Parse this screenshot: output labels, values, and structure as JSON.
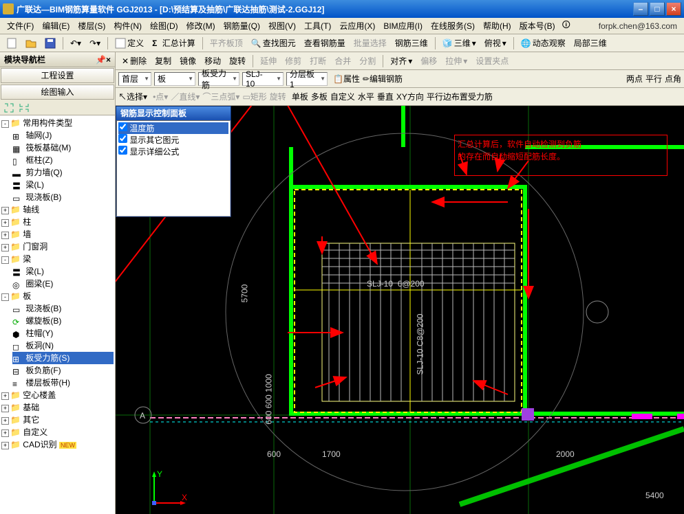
{
  "titlebar": {
    "title": "广联达—BIM钢筋算量软件 GGJ2013 - [D:\\预结算及抽筋\\广联达抽筋\\测试-2.GGJ12]"
  },
  "menubar": {
    "items": [
      "文件(F)",
      "编辑(E)",
      "楼层(S)",
      "构件(N)",
      "绘图(D)",
      "修改(M)",
      "钢筋量(Q)",
      "视图(V)",
      "工具(T)",
      "云应用(X)",
      "BIM应用(I)",
      "在线服务(S)",
      "帮助(H)",
      "版本号(B)"
    ],
    "user": "forpk.chen@163.com"
  },
  "toolbar1": {
    "back": "◄",
    "fwd": "►",
    "define": "定义",
    "sum": "汇总计算",
    "flat": "平齐板顶",
    "find": "查找图元",
    "view_rebar": "查看钢筋量",
    "batch": "批量选择",
    "rebar_3d": "钢筋三维",
    "td": "三维",
    "pan": "俯视",
    "dyn": "动态观察",
    "local3d": "局部三维"
  },
  "toolbar2": {
    "del": "删除",
    "copy": "复制",
    "mir": "镜像",
    "mov": "移动",
    "rot": "旋转",
    "ext": "延伸",
    "trim": "修剪",
    "brk": "打断",
    "merge": "合并",
    "split": "分割",
    "align": "对齐",
    "offset": "偏移",
    "stretch": "拉伸",
    "setjig": "设置夹点"
  },
  "sub_tb1": {
    "floor": "首层",
    "member": "板",
    "sub": "板受力筋",
    "id": "SLJ-10",
    "layer": "分层板1",
    "prop": "属性",
    "edit": "编辑钢筋",
    "two_pt": "两点",
    "par": "平行",
    "pt_angle": "点角"
  },
  "sub_tb2": {
    "sel": "选择",
    "pt": "点",
    "line": "直线",
    "tri": "三点弧",
    "rect": "矩形",
    "rot": "旋转",
    "single": "单板",
    "multi": "多板",
    "def": "自定义",
    "horz": "水平",
    "vert": "垂直",
    "xy": "XY方向",
    "par_side": "平行边布置受力筋"
  },
  "sidebar": {
    "nav_title": "模块导航栏",
    "tab1": "工程设置",
    "tab2": "绘图输入"
  },
  "tree": {
    "n0": "常用构件类型",
    "n0_0": "轴网(J)",
    "n0_1": "筏板基础(M)",
    "n0_2": "框柱(Z)",
    "n0_3": "剪力墙(Q)",
    "n0_4": "梁(L)",
    "n0_5": "现浇板(B)",
    "n1": "轴线",
    "n2": "柱",
    "n3": "墙",
    "n4": "门窗洞",
    "n5": "梁",
    "n5_0": "梁(L)",
    "n5_1": "圈梁(E)",
    "n6": "板",
    "n6_0": "现浇板(B)",
    "n6_1": "螺旋板(B)",
    "n6_2": "柱帽(Y)",
    "n6_3": "板洞(N)",
    "n6_4": "板受力筋(S)",
    "n6_5": "板负筋(F)",
    "n6_6": "楼层板带(H)",
    "n7": "空心楼盖",
    "n8": "基础",
    "n9": "其它",
    "n10": "自定义",
    "n11": "CAD识别",
    "new_badge": "NEW"
  },
  "panel": {
    "title": "钢筋显示控制面板",
    "c1": "温度筋",
    "c2": "显示其它图元",
    "c3": "显示详细公式"
  },
  "annotation": {
    "line1": "汇总计算后，软件自动检测到负筋",
    "line2": "的存在而自动缩短配筋长度。"
  },
  "dims": {
    "d1": "5700",
    "d2": "600 600  1000",
    "d3": "600",
    "d4": "1700",
    "d5": "2000",
    "d6": "5400",
    "label1": "SLJ-10",
    "label2": "6@200",
    "label3": "SLJ-10 C8@200",
    "axis_a": "A",
    "ax_y": "Y",
    "ax_x": "X"
  }
}
